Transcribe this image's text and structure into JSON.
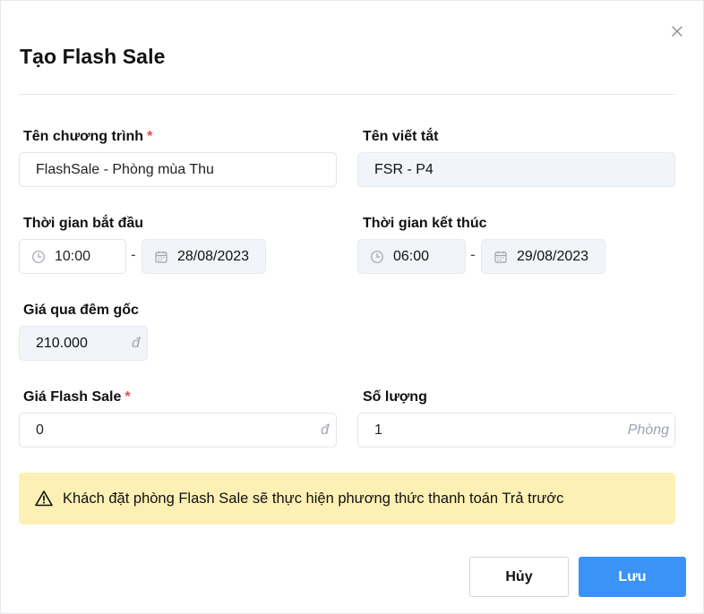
{
  "modal": {
    "title": "Tạo Flash Sale"
  },
  "form": {
    "program_name": {
      "label": "Tên chương trình",
      "required": "*",
      "value": "FlashSale - Phòng mùa Thu"
    },
    "short_name": {
      "label": "Tên viết tắt",
      "value": "FSR - P4"
    },
    "start": {
      "label": "Thời gian bắt đầu",
      "time": "10:00",
      "separator": "-",
      "date": "28/08/2023"
    },
    "end": {
      "label": "Thời gian kết thúc",
      "time": "06:00",
      "separator": "-",
      "date": "29/08/2023"
    },
    "original_price": {
      "label": "Giá qua đêm gốc",
      "value": "210.000",
      "suffix": "đ"
    },
    "flash_price": {
      "label": "Giá Flash Sale",
      "required": "*",
      "value": "0",
      "suffix": "đ"
    },
    "quantity": {
      "label": "Số lượng",
      "value": "1",
      "suffix": "Phòng"
    }
  },
  "alert": {
    "text": "Khách đặt phòng Flash Sale sẽ thực hiện phương thức thanh toán Trả trước",
    "bg_color": "#fdf0b4"
  },
  "footer": {
    "cancel_label": "Hủy",
    "save_label": "Lưu",
    "accent_color": "#3b93f7"
  },
  "icons": {
    "close": "close-icon",
    "clock": "clock-icon",
    "calendar": "calendar-icon",
    "warning": "warning-icon"
  }
}
